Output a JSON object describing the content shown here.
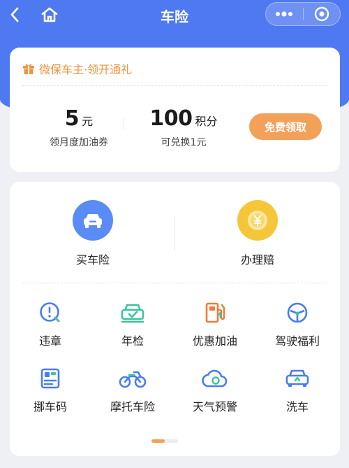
{
  "header": {
    "title": "车险",
    "back_icon": "chevron-left-icon",
    "home_icon": "home-icon",
    "more_icon": "more-dots-icon",
    "close_icon": "record-circle-icon"
  },
  "promo": {
    "heading": "微保车主·领开通礼",
    "gift_icon": "gift-icon",
    "stats": [
      {
        "value": "5",
        "unit": "元",
        "label": "领月度加油券"
      },
      {
        "value": "100",
        "unit": "积分",
        "label": "可兑换1元"
      }
    ],
    "claim_button": "免费领取"
  },
  "services": {
    "primary": [
      {
        "label": "买车险",
        "icon": "car-icon",
        "color": "#5b8bf5"
      },
      {
        "label": "办理赔",
        "icon": "yuan-coin-icon",
        "color": "#f5c63a"
      }
    ],
    "grid": [
      {
        "label": "违章",
        "icon": "violation-icon"
      },
      {
        "label": "年检",
        "icon": "annual-inspection-icon"
      },
      {
        "label": "优惠加油",
        "icon": "fuel-pump-icon"
      },
      {
        "label": "驾驶福利",
        "icon": "steering-wheel-icon"
      },
      {
        "label": "挪车码",
        "icon": "move-car-code-icon"
      },
      {
        "label": "摩托车险",
        "icon": "motorcycle-icon"
      },
      {
        "label": "天气预警",
        "icon": "weather-icon"
      },
      {
        "label": "洗车",
        "icon": "car-wash-icon"
      }
    ]
  },
  "pager": {
    "page": 1,
    "total": 2,
    "progress": 0.5
  },
  "colors": {
    "brand_blue": "#4f79f1",
    "accent_orange": "#f3a15a",
    "icon_blue": "#4a7cf0",
    "icon_green": "#3cc3a0",
    "icon_orange": "#f07a3a"
  }
}
